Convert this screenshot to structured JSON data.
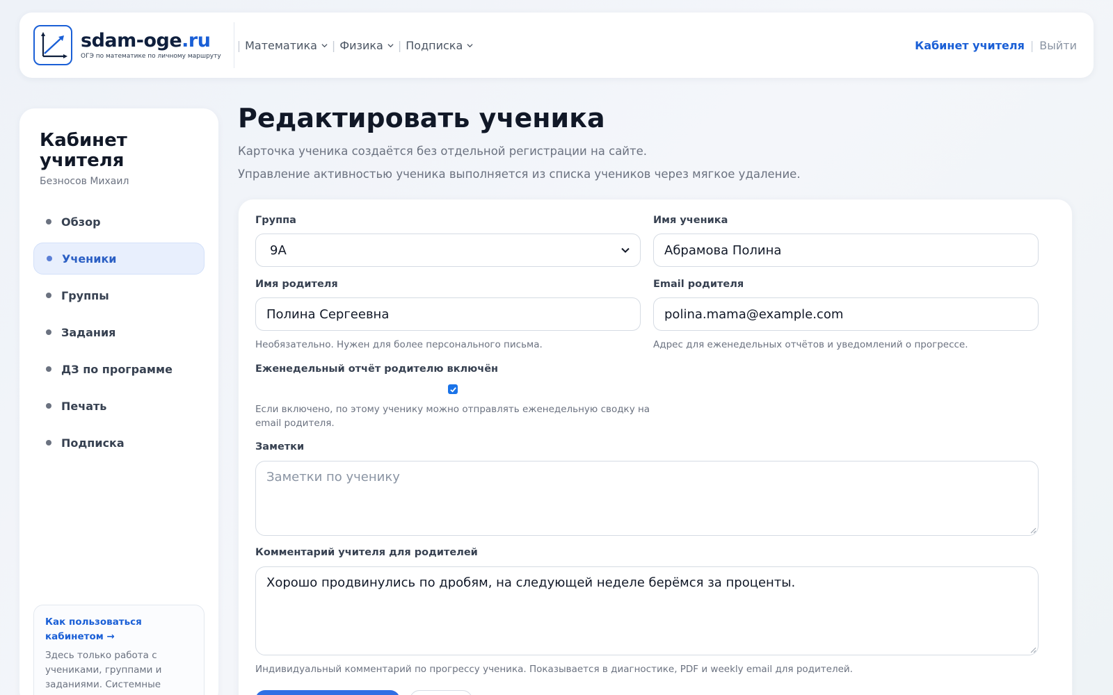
{
  "header": {
    "logo_name": "sdam-oge",
    "logo_tld": ".ru",
    "logo_tagline": "ОГЭ по математике по личному маршруту",
    "nav": [
      {
        "label": "Математика"
      },
      {
        "label": "Физика"
      },
      {
        "label": "Подписка"
      }
    ],
    "cabinet_link": "Кабинет учителя",
    "logout_link": "Выйти"
  },
  "sidebar": {
    "title": "Кабинет учителя",
    "user": "Безносов Михаил",
    "items": [
      {
        "label": "Обзор",
        "active": false
      },
      {
        "label": "Ученики",
        "active": true
      },
      {
        "label": "Группы",
        "active": false
      },
      {
        "label": "Задания",
        "active": false
      },
      {
        "label": "ДЗ по программе",
        "active": false
      },
      {
        "label": "Печать",
        "active": false
      },
      {
        "label": "Подписка",
        "active": false
      }
    ],
    "help_link": "Как пользоваться кабинетом →",
    "help_text": "Здесь только работа с учениками, группами и заданиями. Системные"
  },
  "page": {
    "title": "Редактировать ученика",
    "subtitle_1": "Карточка ученика создаётся без отдельной регистрации на сайте.",
    "subtitle_2": "Управление активностью ученика выполняется из списка учеников через мягкое удаление."
  },
  "form": {
    "group_label": "Группа",
    "group_value": "9А",
    "student_name_label": "Имя ученика",
    "student_name_value": "Абрамова Полина",
    "parent_name_label": "Имя родителя",
    "parent_name_value": "Полина Сергеевна",
    "parent_name_hint": "Необязательно. Нужен для более персонального письма.",
    "parent_email_label": "Email родителя",
    "parent_email_value": "polina.mama@example.com",
    "parent_email_hint": "Адрес для еженедельных отчётов и уведомлений о прогрессе.",
    "weekly_report_label": "Еженедельный отчёт родителю включён",
    "weekly_report_checked": true,
    "weekly_report_hint_1": "Если включено, по этому ученику можно отправлять еженедельную сводку на",
    "weekly_report_hint_2": "email родителя.",
    "notes_label": "Заметки",
    "notes_placeholder": "Заметки по ученику",
    "comment_label": "Комментарий учителя для родителей",
    "comment_value": "Хорошо продвинулись по дробям, на следующей неделе берёмся за проценты.",
    "comment_hint": "Индивидуальный комментарий по прогрессу ученика. Показывается в диагностике, PDF и weekly email для родителей."
  },
  "colors": {
    "accent": "#1a5fd6",
    "button_primary": "#2f6fe4",
    "active_bg": "#e8effd"
  }
}
